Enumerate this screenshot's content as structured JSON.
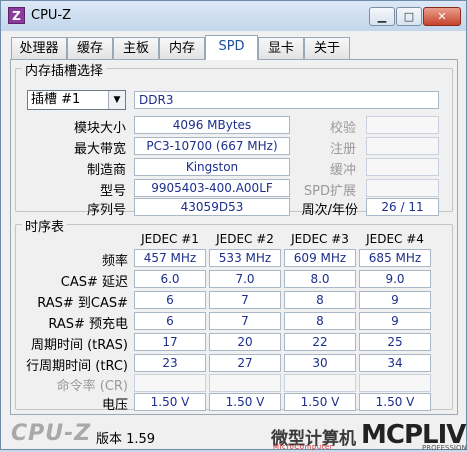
{
  "window": {
    "title": "CPU-Z",
    "app_icon": "Z"
  },
  "tabs": [
    "处理器",
    "缓存",
    "主板",
    "内存",
    "SPD",
    "显卡",
    "关于"
  ],
  "active_tab": "SPD",
  "slot_group": {
    "title": "内存插槽选择",
    "slot_select": "插槽 #1",
    "type": "DDR3",
    "labels": {
      "module_size": "模块大小",
      "max_bandwidth": "最大带宽",
      "manufacturer": "制造商",
      "part_number": "型号",
      "serial_number": "序列号",
      "correction": "校验",
      "registered": "注册",
      "buffered": "缓冲",
      "spd_ext": "SPD扩展",
      "week_year": "周次/年份"
    },
    "values": {
      "module_size": "4096 MBytes",
      "max_bandwidth": "PC3-10700 (667 MHz)",
      "manufacturer": "Kingston",
      "part_number": "9905403-400.A00LF",
      "serial_number": "43059D53",
      "week_year": "26 / 11"
    }
  },
  "timings_group": {
    "title": "时序表",
    "columns": [
      "JEDEC #1",
      "JEDEC #2",
      "JEDEC #3",
      "JEDEC #4"
    ],
    "rows": [
      {
        "label": "频率",
        "values": [
          "457 MHz",
          "533 MHz",
          "609 MHz",
          "685 MHz"
        ]
      },
      {
        "label": "CAS# 延迟",
        "values": [
          "6.0",
          "7.0",
          "8.0",
          "9.0"
        ]
      },
      {
        "label": "RAS# 到CAS#",
        "values": [
          "6",
          "7",
          "8",
          "9"
        ]
      },
      {
        "label": "RAS# 预充电",
        "values": [
          "6",
          "7",
          "8",
          "9"
        ]
      },
      {
        "label": "周期时间 (tRAS)",
        "values": [
          "17",
          "20",
          "22",
          "25"
        ]
      },
      {
        "label": "行周期时间 (tRC)",
        "values": [
          "23",
          "27",
          "30",
          "34"
        ]
      },
      {
        "label": "命令率 (CR)",
        "values": [
          "",
          "",
          "",
          ""
        ]
      },
      {
        "label": "电压",
        "values": [
          "1.50 V",
          "1.50 V",
          "1.50 V",
          "1.50 V"
        ]
      }
    ]
  },
  "footer": {
    "brand": "CPU-Z",
    "version_label": "版本 1.59",
    "watermark_cn": "微型计算机",
    "watermark_en": "MicroComputer",
    "watermark_logo": "MCPLIVE",
    "watermark_sub": "PROFESSIONAL"
  }
}
